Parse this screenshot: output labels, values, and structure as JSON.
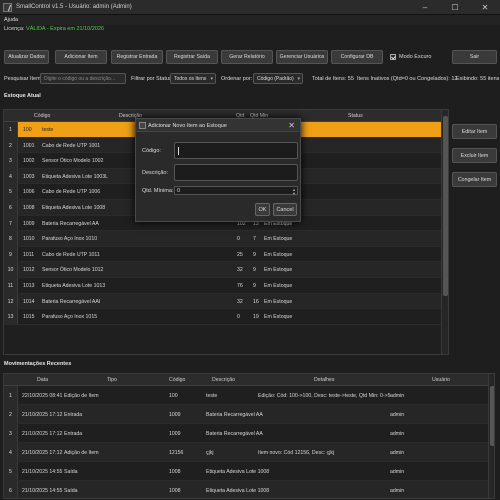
{
  "window": {
    "title": "SmallControl v1.5 - Usuário: admin (Admin)"
  },
  "menu": {
    "help": "Ajuda"
  },
  "license": {
    "label": "Licença:",
    "status": "VÁLIDA - Expira em 21/10/2026"
  },
  "toolbar": {
    "buttons": [
      "Atualizar Dados",
      "Adicionar Item",
      "Registrar Entrada",
      "Registrar Saída",
      "Gerar Relatório",
      "Gerenciar Usuários",
      "Configurar DB"
    ],
    "dark_mode": "Modo Escuro",
    "exit": "Sair"
  },
  "filters": {
    "search_label": "Pesquisar Item:",
    "search_placeholder": "Digite o código ou a descrição...",
    "status_label": "Filtrar por Status:",
    "status_value": "Todos os Itens",
    "order_label": "Ordenar por:",
    "order_value": "Código (Padrão)",
    "total": "Total de Itens: 55",
    "inactive": "Itens Inativos (Qtd=0 ou Congelados): 12",
    "showing": "Exibindo: 55 itens"
  },
  "stock": {
    "title": "Estoque Atual",
    "headers": [
      "Código",
      "Descrição",
      "Qtd",
      "Qtd Min",
      "Status"
    ],
    "rows": [
      {
        "n": "1",
        "code": "100",
        "desc": "teste",
        "qty": "",
        "min": "",
        "status": ""
      },
      {
        "n": "2",
        "code": "1001",
        "desc": "Cabo de Rede UTP 1001",
        "qty": "",
        "min": "",
        "status": ""
      },
      {
        "n": "3",
        "code": "1002",
        "desc": "Sensor Ótico Modelo 1002",
        "qty": "",
        "min": "",
        "status": ""
      },
      {
        "n": "4",
        "code": "1003",
        "desc": "Etiqueta Adesiva Lote 1003L",
        "qty": "",
        "min": "",
        "status": ""
      },
      {
        "n": "5",
        "code": "1006",
        "desc": "Cabo de Rede UTP 1006",
        "qty": "",
        "min": "",
        "status": ""
      },
      {
        "n": "6",
        "code": "1008",
        "desc": "Etiqueta Adesiva Lote 1008",
        "qty": "",
        "min": "",
        "status": ""
      },
      {
        "n": "7",
        "code": "1009",
        "desc": "Bateria Recarregável AA",
        "qty": "102",
        "min": "13",
        "status": "Em Estoque"
      },
      {
        "n": "8",
        "code": "1010",
        "desc": "Parafuso Aço Inox 1010",
        "qty": "0",
        "min": "7",
        "status": "Em Estoque"
      },
      {
        "n": "9",
        "code": "1011",
        "desc": "Cabo de Rede UTP 1011",
        "qty": "25",
        "min": "9",
        "status": "Em Estoque"
      },
      {
        "n": "10",
        "code": "1012",
        "desc": "Sensor Ótico Modelo 1012",
        "qty": "32",
        "min": "9",
        "status": "Em Estoque"
      },
      {
        "n": "11",
        "code": "1013",
        "desc": "Etiqueta Adesiva Lote 1013",
        "qty": "76",
        "min": "9",
        "status": "Em Estoque"
      },
      {
        "n": "12",
        "code": "1014",
        "desc": "Bateria Recarregável AAI",
        "qty": "32",
        "min": "16",
        "status": "Em Estoque"
      },
      {
        "n": "13",
        "code": "1015",
        "desc": "Parafuso Aço Inox 1015",
        "qty": "0",
        "min": "19",
        "status": "Em Estoque"
      }
    ]
  },
  "side_buttons": [
    "Editar Item",
    "Excluir Item",
    "Congelar Item"
  ],
  "movements": {
    "title": "Movimentações Recentes",
    "headers": [
      "Data",
      "Tipo",
      "Código",
      "Descrição",
      "Detalhes",
      "Usuário"
    ],
    "rows": [
      {
        "n": "1",
        "date": "22/10/2025 08:41",
        "type": "Edição de Item",
        "code": "100",
        "desc": "teste",
        "details": "Edição: Cód: 100->100, Desc: teste->teste, Qtd Min: 0->5",
        "user": "admin"
      },
      {
        "n": "2",
        "date": "21/10/2025 17:12",
        "type": "Entrada",
        "code": "1009",
        "desc": "Bateria Recarregável AA",
        "details": "",
        "user": "admin"
      },
      {
        "n": "3",
        "date": "21/10/2025 17:12",
        "type": "Entrada",
        "code": "1009",
        "desc": "Bateria Recarregável AA",
        "details": "",
        "user": "admin"
      },
      {
        "n": "4",
        "date": "21/10/2025 17:12",
        "type": "Adição de Item",
        "code": "12156",
        "desc": "çjkj",
        "details": "Item novo: Cód 12156, Desc: çjkj",
        "user": "admin"
      },
      {
        "n": "5",
        "date": "21/10/2025 14:55",
        "type": "Saída",
        "code": "1008",
        "desc": "Etiqueta Adesiva Lote 1008",
        "details": "",
        "user": "admin"
      },
      {
        "n": "6",
        "date": "21/10/2025 14:55",
        "type": "Saída",
        "code": "1008",
        "desc": "Etiqueta Adesiva Lote 1008",
        "details": "",
        "user": "admin"
      }
    ]
  },
  "dialog": {
    "title": "Adicionar Novo Item ao Estoque",
    "code_label": "Código:",
    "desc_label": "Descrição:",
    "min_label": "Qtd. Mínima:",
    "min_value": "0",
    "ok": "OK",
    "cancel": "Cancel"
  },
  "colors": {
    "selected_row": "#f0a016",
    "license_ok": "#4fd14f",
    "background": "#1e1e1e"
  }
}
